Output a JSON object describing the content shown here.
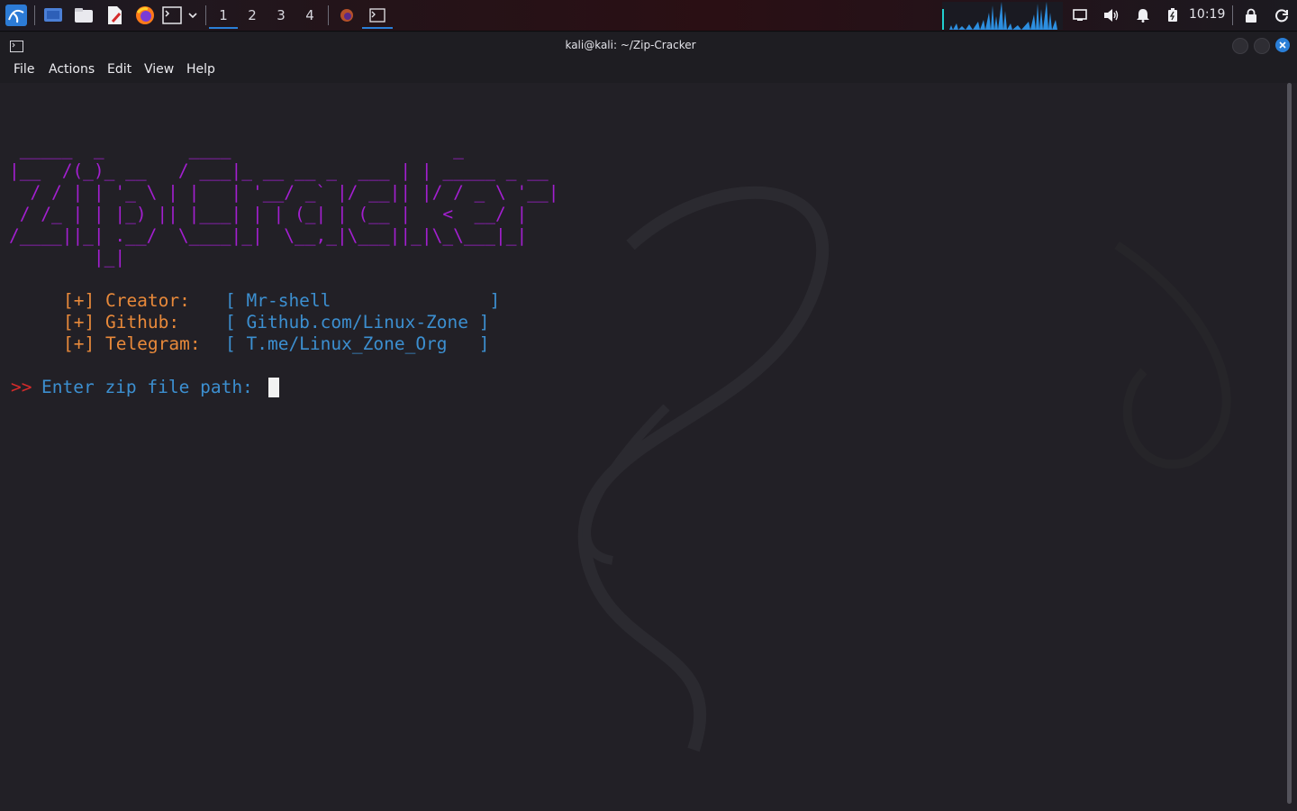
{
  "panel": {
    "workspaces": [
      "1",
      "2",
      "3",
      "4"
    ],
    "active_workspace": "1",
    "clock": "10:19",
    "icons": [
      "kali-menu-icon",
      "desktop-icon",
      "files-icon",
      "text-editor-icon",
      "firefox-icon",
      "terminal-icon",
      "chevron-down-icon",
      "firefox-task-icon",
      "terminal-task-icon",
      "cpu-graph-icon",
      "display-icon",
      "volume-icon",
      "bell-icon",
      "battery-icon",
      "lock-icon",
      "power-icon"
    ]
  },
  "window": {
    "title": "kali@kali: ~/Zip-Cracker",
    "menu": [
      "File",
      "Actions",
      "Edit",
      "View",
      "Help"
    ]
  },
  "terminal": {
    "banner": [
      " _____  _        ____                     _",
      "|__  /(_)_ __   / ___|_ __ __ _  ___ | | _____ _ __",
      "  / / | | '_ \\ | |   | '__/ _` |/ __|| |/ / _ \\ '__|",
      " / /_ | | |_) || |___| | | (_| | (__ |   <  __/ |",
      "/____||_| .__/  \\____|_|  \\__,_|\\___||_|\\_\\___|_|",
      "        |_|"
    ],
    "info": [
      {
        "label": "[+] Creator:",
        "value": "[ Mr-shell               ]"
      },
      {
        "label": "[+] Github:",
        "value": "[ Github.com/Linux-Zone ]"
      },
      {
        "label": "[+] Telegram:",
        "value": "[ T.me/Linux_Zone_Org   ]"
      }
    ],
    "prompt_marker": ">>",
    "prompt_text": "Enter zip file path:"
  },
  "colors": {
    "ascii": "#a31fd0",
    "label": "#e8893a",
    "value": "#3c8fd0",
    "prompt_marker": "#d62b2b",
    "close_button": "#2a7fd8"
  }
}
